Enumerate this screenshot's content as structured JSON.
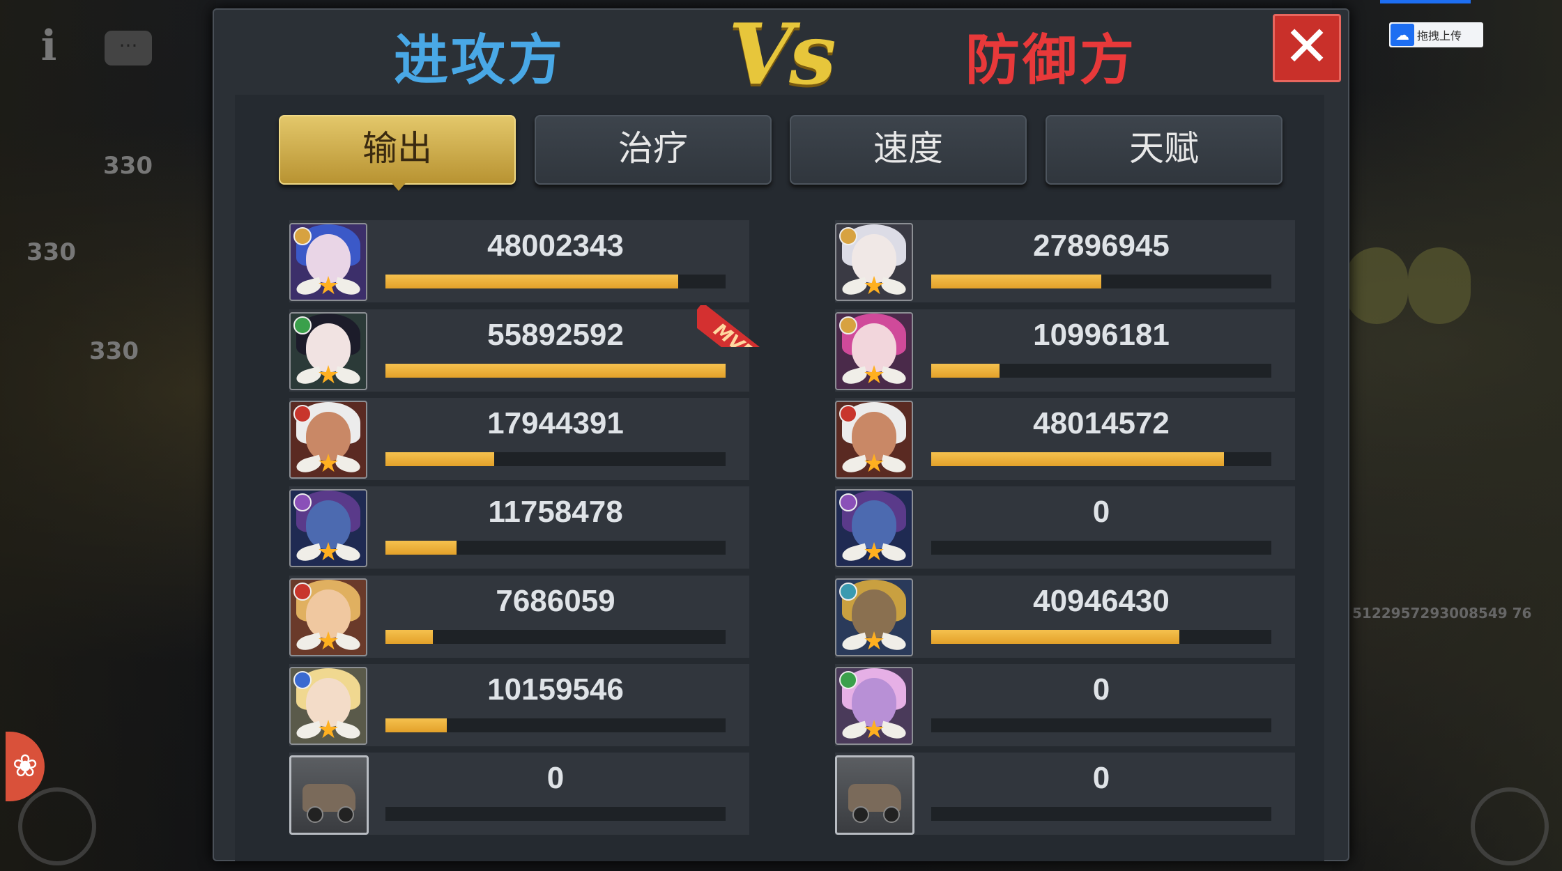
{
  "header": {
    "attacker_label": "进攻方",
    "vs_label": "Vs",
    "defender_label": "防御方",
    "close_glyph": "✕"
  },
  "tabs": [
    {
      "label": "输出",
      "active": true
    },
    {
      "label": "治疗",
      "active": false
    },
    {
      "label": "速度",
      "active": false
    },
    {
      "label": "天赋",
      "active": false
    }
  ],
  "mvp_label": "MVP",
  "background": {
    "level_1": "330",
    "level_2": "330",
    "level_3": "330",
    "cloud_upload_label": "拖拽上传",
    "side_id": "5122957293008549 76"
  },
  "attackers": [
    {
      "value": "48002343",
      "fill": 0.86,
      "avatar_icon": "hero-blue-hair-icon"
    },
    {
      "value": "55892592",
      "fill": 1.0,
      "avatar_icon": "hero-dark-hair-icon",
      "mvp": true
    },
    {
      "value": "17944391",
      "fill": 0.32,
      "avatar_icon": "hero-old-man-icon"
    },
    {
      "value": "11758478",
      "fill": 0.21,
      "avatar_icon": "hero-dragon-icon"
    },
    {
      "value": "7686059",
      "fill": 0.14,
      "avatar_icon": "hero-blonde-warrior-icon"
    },
    {
      "value": "10159546",
      "fill": 0.18,
      "avatar_icon": "hero-blonde-girl-icon"
    },
    {
      "value": "0",
      "fill": 0,
      "avatar_icon": "vehicle-car-icon"
    }
  ],
  "defenders": [
    {
      "value": "27896945",
      "fill": 0.5,
      "avatar_icon": "hero-white-hair-icon"
    },
    {
      "value": "10996181",
      "fill": 0.2,
      "avatar_icon": "hero-pink-hair-icon"
    },
    {
      "value": "48014572",
      "fill": 0.86,
      "avatar_icon": "hero-old-man-icon"
    },
    {
      "value": "0",
      "fill": 0,
      "avatar_icon": "hero-dragon-icon"
    },
    {
      "value": "40946430",
      "fill": 0.73,
      "avatar_icon": "hero-golden-knight-icon"
    },
    {
      "value": "0",
      "fill": 0,
      "avatar_icon": "hero-purple-hair-icon"
    },
    {
      "value": "0",
      "fill": 0,
      "avatar_icon": "vehicle-tank-icon"
    }
  ],
  "colors": {
    "attacker": "#49a8e6",
    "defender": "#e8393a",
    "vs": "#e7c63b",
    "bar_fill": "#f0b43c",
    "active_tab": "#d1b04f"
  }
}
